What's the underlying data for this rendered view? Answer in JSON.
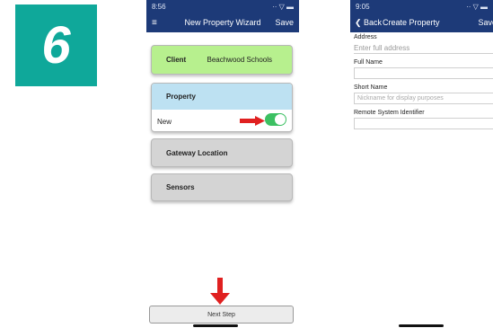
{
  "step_number": "6",
  "left_phone": {
    "status_time": "8:56",
    "status_icons": "·· ▽ ▬",
    "nav": {
      "menu_icon": "≡",
      "title": "New Property Wizard",
      "save_label": "Save"
    },
    "client_card": {
      "label": "Client",
      "value": "Beachwood Schools"
    },
    "property_card": {
      "label": "Property",
      "new_label": "New",
      "toggle_on": true
    },
    "gateway_card": {
      "label": "Gateway Location"
    },
    "sensors_card": {
      "label": "Sensors"
    },
    "next_step_label": "Next Step"
  },
  "right_phone": {
    "status_time": "9:05",
    "status_icons": "·· ▽ ▬",
    "nav": {
      "back_label": "❮ Back",
      "title": "Create Property",
      "save_label": "Save"
    },
    "fields": [
      {
        "label": "Address",
        "placeholder": "Enter full address"
      },
      {
        "label": "Full Name",
        "placeholder": ""
      },
      {
        "label": "Short Name",
        "placeholder": "Nickname for display purposes"
      },
      {
        "label": "Remote System Identifier",
        "placeholder": ""
      }
    ]
  },
  "colors": {
    "badge": "#0fa89a",
    "navbar": "#1d3a78",
    "client": "#b7f08e",
    "property": "#bde1f2",
    "arrow": "#e02020",
    "toggle": "#3cc062"
  }
}
